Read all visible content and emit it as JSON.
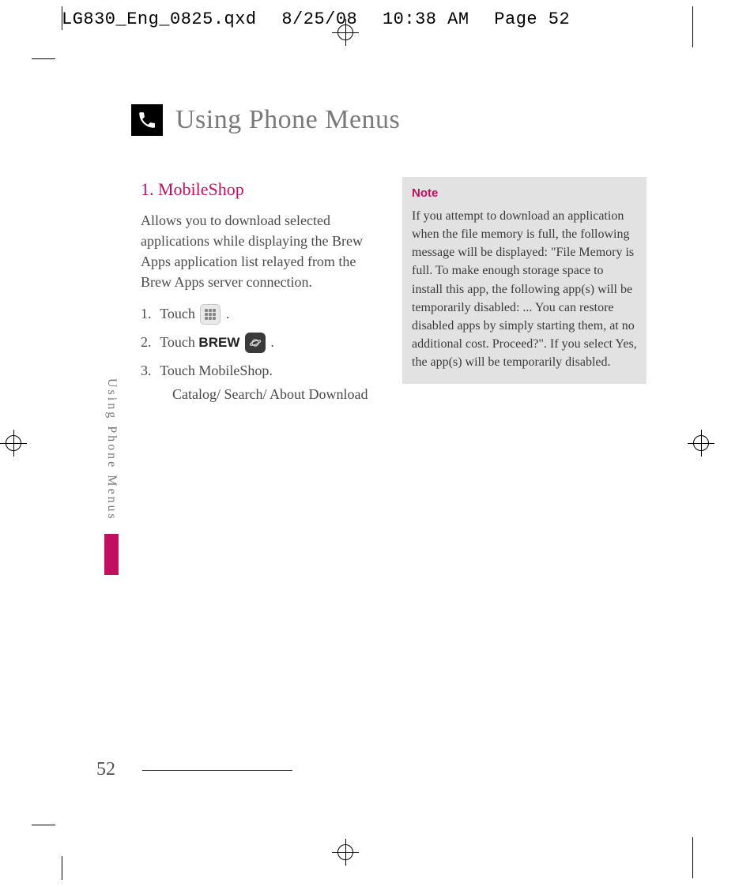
{
  "slug": {
    "file": "LG830_Eng_0825.qxd",
    "date": "8/25/08",
    "time": "10:38 AM",
    "page_label": "Page 52"
  },
  "chapter_title": "Using Phone Menus",
  "section": {
    "heading": "1. MobileShop",
    "intro": "Allows you to download selected applications while displaying the Brew Apps application list relayed from the Brew Apps server connection.",
    "steps": [
      {
        "n": "1.",
        "pre": "Touch ",
        "post": "."
      },
      {
        "n": "2.",
        "pre": "Touch ",
        "bold": "BREW",
        "post": "."
      },
      {
        "n": "3.",
        "pre": "Touch MobileShop.",
        "sub": "Catalog/ Search/ About Download"
      }
    ]
  },
  "note": {
    "heading": "Note",
    "body": "If you attempt to download an application when the file memory is full, the following message will be displayed: \"File Memory is full. To make enough storage space to install this app, the following app(s) will be temporarily disabled: ...  You can restore disabled apps by simply starting them, at no additional cost. Proceed?\". If you select Yes, the app(s) will be temporarily disabled."
  },
  "side_tab": "Using Phone Menus",
  "folio": "52"
}
